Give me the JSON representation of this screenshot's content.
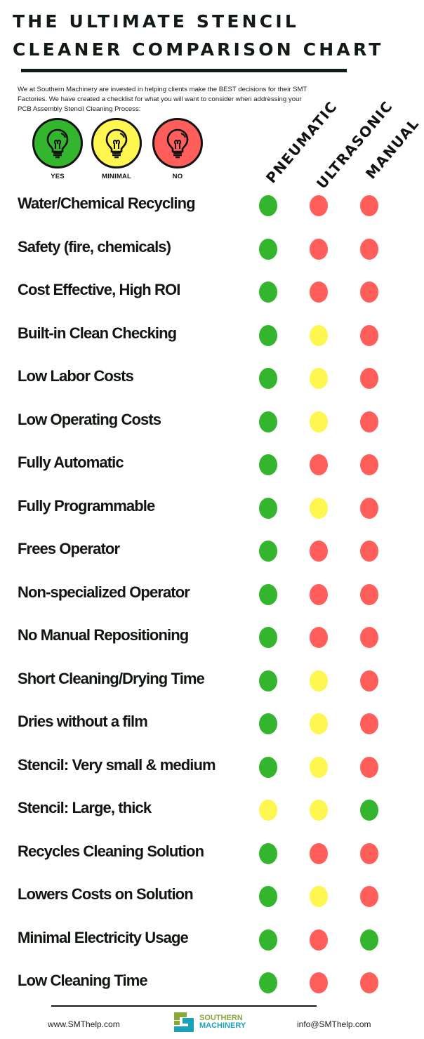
{
  "header": {
    "title_line1": "THE ULTIMATE STENCIL",
    "title_line2": "CLEANER COMPARISON CHART",
    "intro": "We at Southern Machinery are invested in helping clients make the BEST decisions for their SMT Factories. We have created a checklist for what you will want to consider when addressing your PCB Assembly Stencil Cleaning Process:"
  },
  "legend": [
    {
      "key": "yes",
      "label": "YES",
      "color": "#33b52d",
      "icon": "lightbulb-icon"
    },
    {
      "key": "minimal",
      "label": "MINIMAL",
      "color": "#fff64f",
      "icon": "lightbulb-icon"
    },
    {
      "key": "no",
      "label": "NO",
      "color": "#ff5e5b",
      "icon": "lightbulb-icon"
    }
  ],
  "colors": {
    "yes": "#33b52d",
    "minimal": "#fff64f",
    "no": "#ff5e5b",
    "text": "#111611"
  },
  "chart_data": {
    "type": "table",
    "title": "The Ultimate Stencil Cleaner Comparison Chart",
    "columns": [
      "PNEUMATIC",
      "ULTRASONIC",
      "MANUAL"
    ],
    "legend": [
      "yes",
      "minimal",
      "no"
    ],
    "rows": [
      {
        "label": "Water/Chemical Recycling",
        "values": [
          "yes",
          "no",
          "no"
        ]
      },
      {
        "label": "Safety (fire, chemicals)",
        "values": [
          "yes",
          "no",
          "no"
        ]
      },
      {
        "label": "Cost Effective, High ROI",
        "values": [
          "yes",
          "no",
          "no"
        ]
      },
      {
        "label": "Built-in Clean Checking",
        "values": [
          "yes",
          "minimal",
          "no"
        ]
      },
      {
        "label": "Low Labor Costs",
        "values": [
          "yes",
          "minimal",
          "no"
        ]
      },
      {
        "label": "Low Operating Costs",
        "values": [
          "yes",
          "minimal",
          "no"
        ]
      },
      {
        "label": "Fully Automatic",
        "values": [
          "yes",
          "no",
          "no"
        ]
      },
      {
        "label": "Fully Programmable",
        "values": [
          "yes",
          "minimal",
          "no"
        ]
      },
      {
        "label": "Frees Operator",
        "values": [
          "yes",
          "no",
          "no"
        ]
      },
      {
        "label": "Non-specialized Operator",
        "values": [
          "yes",
          "no",
          "no"
        ]
      },
      {
        "label": "No Manual Repositioning",
        "values": [
          "yes",
          "no",
          "no"
        ]
      },
      {
        "label": "Short Cleaning/Drying Time",
        "values": [
          "yes",
          "minimal",
          "no"
        ]
      },
      {
        "label": "Dries without a film",
        "values": [
          "yes",
          "minimal",
          "no"
        ]
      },
      {
        "label": "Stencil: Very small & medium",
        "values": [
          "yes",
          "minimal",
          "no"
        ]
      },
      {
        "label": "Stencil: Large, thick",
        "values": [
          "minimal",
          "minimal",
          "yes"
        ]
      },
      {
        "label": "Recycles Cleaning Solution",
        "values": [
          "yes",
          "no",
          "no"
        ]
      },
      {
        "label": "Lowers Costs on Solution",
        "values": [
          "yes",
          "minimal",
          "no"
        ]
      },
      {
        "label": "Minimal Electricity Usage",
        "values": [
          "yes",
          "no",
          "yes"
        ]
      },
      {
        "label": "Low Cleaning Time",
        "values": [
          "yes",
          "no",
          "no"
        ]
      }
    ]
  },
  "footer": {
    "website": "www.SMThelp.com",
    "email": "info@SMThelp.com",
    "logo_line1": "SOUTHERN",
    "logo_line2": "MACHINERY",
    "logo_color_green": "#8aa83a",
    "logo_color_teal": "#1aa3b8"
  }
}
